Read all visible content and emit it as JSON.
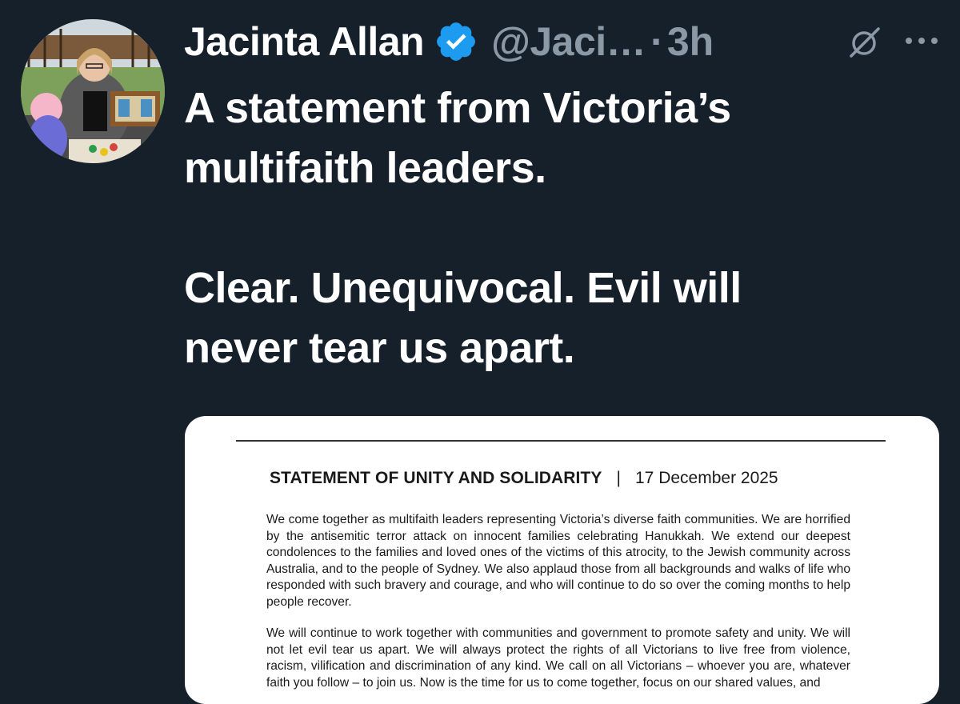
{
  "author": {
    "display_name": "Jacinta Allan",
    "handle": "@Jaci…",
    "separator": "·",
    "time": "3h",
    "verified": true,
    "accent_color": "#1d9bf0"
  },
  "icons": {
    "verified": "verified-badge-icon",
    "grok": "grok-icon",
    "more": "more-options-icon"
  },
  "tweet": {
    "lines_para1": [
      "A statement from Victoria’s",
      "multifaith leaders."
    ],
    "lines_para2": [
      "Clear. Unequivocal. Evil will",
      "never tear us apart."
    ]
  },
  "document": {
    "title": "STATEMENT OF UNITY AND SOLIDARITY",
    "divider": "|",
    "date": "17 December 2025",
    "paragraph1": "We come together as multifaith leaders representing Victoria’s diverse faith communities. We are horrified by the antisemitic terror attack on innocent families celebrating Hanukkah. We extend our deepest condolences to the families and loved ones of the victims of this atrocity, to the Jewish community across Australia, and to the people of Sydney. We also applaud those from all backgrounds and walks of life who responded with such bravery and courage, and who will continue to do so over the coming months to help people recover.",
    "paragraph2": "We will continue to work together with communities and government to promote safety and unity. We will not let evil tear us apart. We will always protect the rights of all Victorians to live free from violence, racism, vilification and discrimination of any kind. We call on all Victorians – whoever you are, whatever faith you follow – to join us. Now is the time for us to come together, focus on our shared values, and"
  },
  "colors": {
    "background": "#15202b",
    "text_primary": "#ffffff",
    "text_secondary": "#8b98a5"
  }
}
